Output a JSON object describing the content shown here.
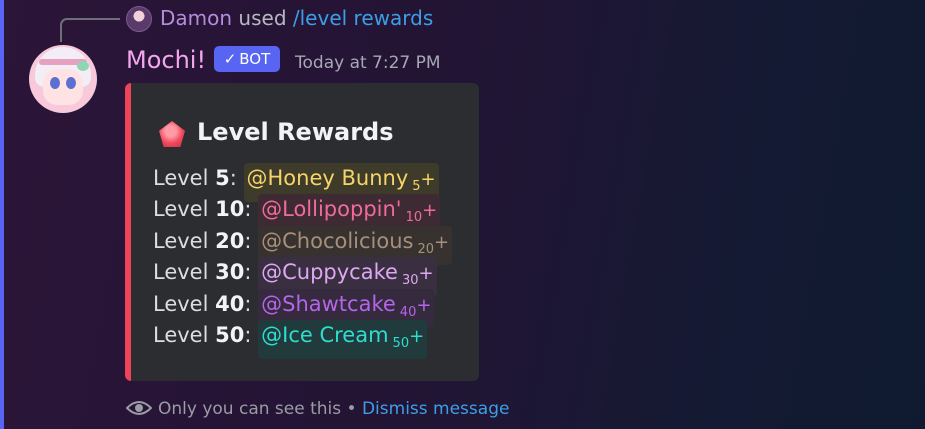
{
  "reply": {
    "user": "Damon",
    "used_text": "used",
    "command": "/level rewards"
  },
  "message": {
    "author": "Mochi!",
    "bot_label": "BOT",
    "timestamp": "Today at 7:27 PM"
  },
  "embed": {
    "accent_color": "#ed4459",
    "icon": "pink-gem-icon",
    "title": "Level Rewards",
    "level_word": "Level",
    "rewards": [
      {
        "level": "5",
        "role": "@Honey Bunny",
        "sub": "5",
        "plus": "+",
        "color": "#f5d46a",
        "bg": "#3f3b2a"
      },
      {
        "level": "10",
        "role": "@Lollipoppin'",
        "sub": "10",
        "plus": "+",
        "color": "#f06b9c",
        "bg": "#3e2a33"
      },
      {
        "level": "20",
        "role": "@Chocolicious",
        "sub": "20",
        "plus": "+",
        "color": "#a7907b",
        "bg": "#37322f"
      },
      {
        "level": "30",
        "role": "@Cuppycake",
        "sub": "30",
        "plus": "+",
        "color": "#dda8f2",
        "bg": "#3a2f40"
      },
      {
        "level": "40",
        "role": "@Shawtcake",
        "sub": "40",
        "plus": "+",
        "color": "#b565e8",
        "bg": "#352a3e"
      },
      {
        "level": "50",
        "role": "@Ice Cream",
        "sub": "50",
        "plus": "+",
        "color": "#2fdcd0",
        "bg": "#213a3b"
      }
    ]
  },
  "ephemeral": {
    "icon": "eye-icon",
    "text": "Only you can see this",
    "separator": "•",
    "dismiss": "Dismiss message"
  }
}
